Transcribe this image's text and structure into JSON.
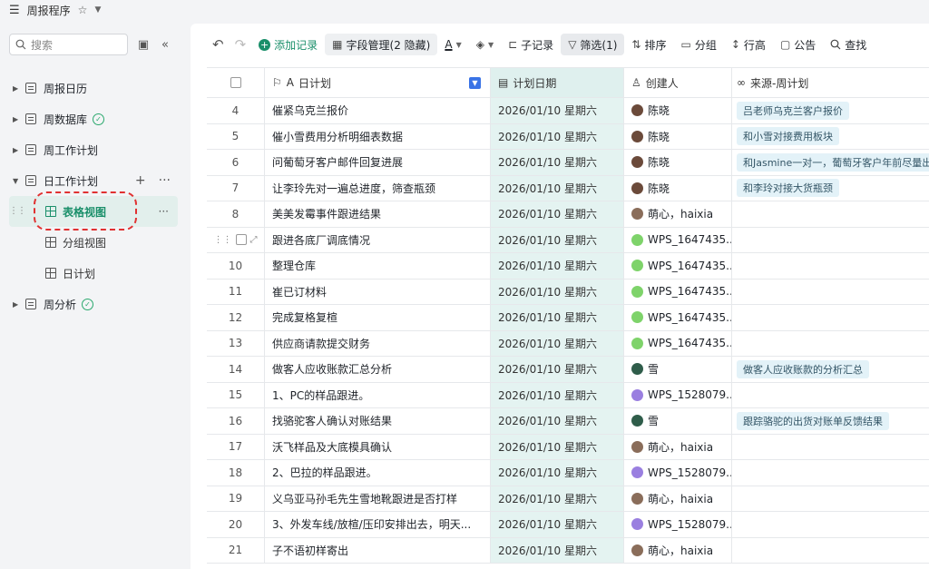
{
  "topbar": {
    "menu_icon": "hamburger-icon",
    "title": "周报程序",
    "star": "☆"
  },
  "sidebar": {
    "search_placeholder": "搜索",
    "tree": [
      {
        "label": "周报日历",
        "expanded": false
      },
      {
        "label": "周数据库",
        "expanded": false,
        "synced": true
      },
      {
        "label": "周工作计划",
        "expanded": false
      },
      {
        "label": "日工作计划",
        "expanded": true
      },
      {
        "label": "周分析",
        "expanded": false,
        "synced": true
      }
    ],
    "views": [
      {
        "label": "表格视图",
        "active": true
      },
      {
        "label": "分组视图"
      },
      {
        "label": "日计划"
      }
    ]
  },
  "toolbar": {
    "add_record": "添加记录",
    "field_manage": "字段管理(2 隐藏)",
    "text_format": "A",
    "sub_record": "子记录",
    "filter": "筛选(1)",
    "sort": "排序",
    "group": "分组",
    "row_height": "行高",
    "announce": "公告",
    "search": "查找"
  },
  "columns": {
    "plan": "日计划",
    "date": "计划日期",
    "creator": "创建人",
    "source": "来源-周计划"
  },
  "rows": [
    {
      "idx": "4",
      "plan": "催紧乌克兰报价",
      "date": "2026/01/10 星期六",
      "creator": "陈晓",
      "avatar_color": "#6b4a3a",
      "source": "吕老师乌克兰客户报价"
    },
    {
      "idx": "5",
      "plan": "催小雪费用分析明细表数据",
      "date": "2026/01/10 星期六",
      "creator": "陈晓",
      "avatar_color": "#6b4a3a",
      "source": "和小雪对接费用板块"
    },
    {
      "idx": "6",
      "plan": "问葡萄牙客户邮件回复进展",
      "date": "2026/01/10 星期六",
      "creator": "陈晓",
      "avatar_color": "#6b4a3a",
      "source": "和Jasmine一对一，葡萄牙客户年前尽量出单"
    },
    {
      "idx": "7",
      "plan": "让李玲先对一遍总进度，筛查瓶颈",
      "date": "2026/01/10 星期六",
      "creator": "陈晓",
      "avatar_color": "#6b4a3a",
      "source": "和李玲对接大货瓶颈"
    },
    {
      "idx": "8",
      "plan": "美美发霉事件跟进结果",
      "date": "2026/01/10 星期六",
      "creator": "萌心，haixia",
      "avatar_color": "#8a6d5a",
      "source": ""
    },
    {
      "idx": "",
      "plan": "跟进各底厂调底情况",
      "date": "2026/01/10 星期六",
      "creator": "WPS_1647435...",
      "avatar_color": "#7ed36a",
      "source": ""
    },
    {
      "idx": "10",
      "plan": "整理仓库",
      "date": "2026/01/10 星期六",
      "creator": "WPS_1647435...",
      "avatar_color": "#7ed36a",
      "source": ""
    },
    {
      "idx": "11",
      "plan": "崔已订材料",
      "date": "2026/01/10 星期六",
      "creator": "WPS_1647435...",
      "avatar_color": "#7ed36a",
      "source": ""
    },
    {
      "idx": "12",
      "plan": "完成复格复楦",
      "date": "2026/01/10 星期六",
      "creator": "WPS_1647435...",
      "avatar_color": "#7ed36a",
      "source": ""
    },
    {
      "idx": "13",
      "plan": "供应商请款提交财务",
      "date": "2026/01/10 星期六",
      "creator": "WPS_1647435...",
      "avatar_color": "#7ed36a",
      "source": ""
    },
    {
      "idx": "14",
      "plan": "做客人应收账款汇总分析",
      "date": "2026/01/10 星期六",
      "creator": "雪",
      "avatar_color": "#2f5d4a",
      "source": "做客人应收账款的分析汇总"
    },
    {
      "idx": "15",
      "plan": "1、PC的样品跟进。",
      "date": "2026/01/10 星期六",
      "creator": "WPS_1528079...",
      "avatar_color": "#9a7fe0",
      "source": ""
    },
    {
      "idx": "16",
      "plan": "找骆驼客人确认对账结果",
      "date": "2026/01/10 星期六",
      "creator": "雪",
      "avatar_color": "#2f5d4a",
      "source": "跟踪骆驼的出货对账单反馈结果"
    },
    {
      "idx": "17",
      "plan": "沃飞样品及大底模具确认",
      "date": "2026/01/10 星期六",
      "creator": "萌心，haixia",
      "avatar_color": "#8a6d5a",
      "source": ""
    },
    {
      "idx": "18",
      "plan": "2、巴拉的样品跟进。",
      "date": "2026/01/10 星期六",
      "creator": "WPS_1528079...",
      "avatar_color": "#9a7fe0",
      "source": ""
    },
    {
      "idx": "19",
      "plan": "义乌亚马孙毛先生雪地靴跟进是否打样",
      "date": "2026/01/10 星期六",
      "creator": "萌心，haixia",
      "avatar_color": "#8a6d5a",
      "source": ""
    },
    {
      "idx": "20",
      "plan": "3、外发车线/放楦/压印安排出去，明天...",
      "date": "2026/01/10 星期六",
      "creator": "WPS_1528079...",
      "avatar_color": "#9a7fe0",
      "source": ""
    },
    {
      "idx": "21",
      "plan": "子不语初样寄出",
      "date": "2026/01/10 星期六",
      "creator": "萌心，haixia",
      "avatar_color": "#8a6d5a",
      "source": ""
    }
  ]
}
